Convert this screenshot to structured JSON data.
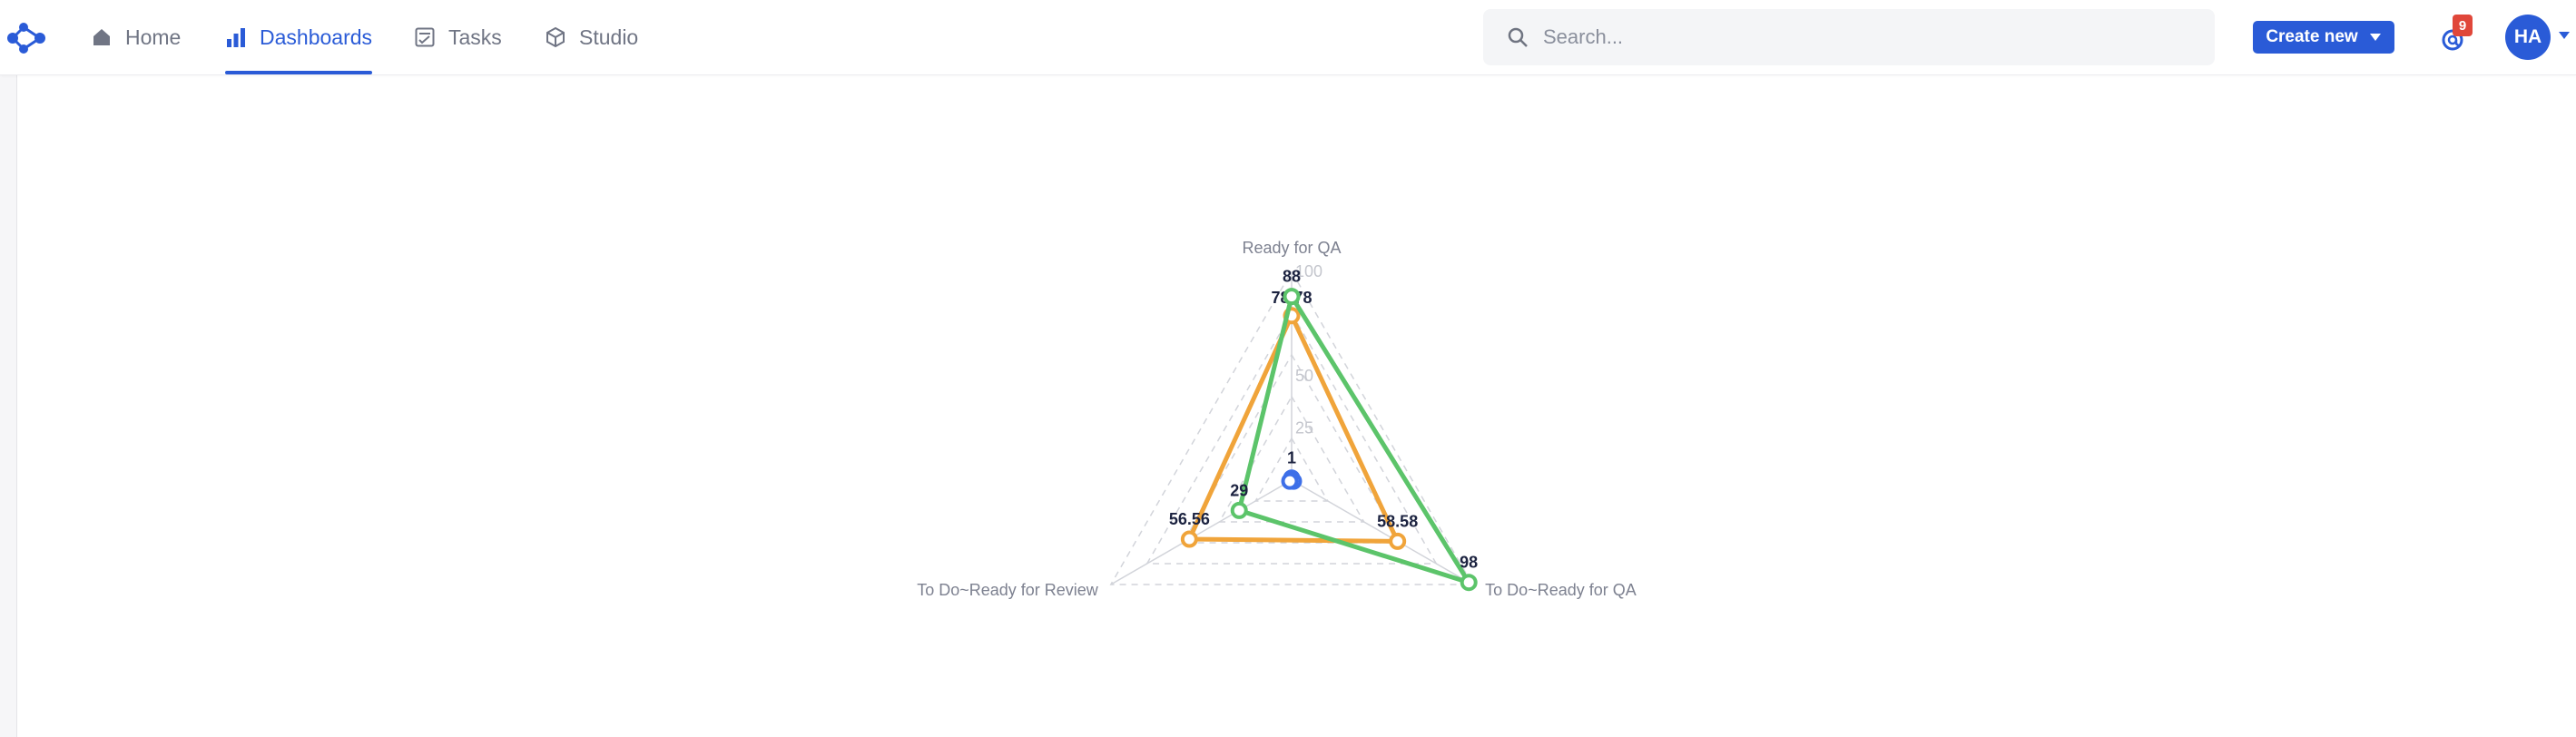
{
  "nav": {
    "items": [
      {
        "label": "Home",
        "icon": "home-icon"
      },
      {
        "label": "Dashboards",
        "icon": "bar-chart-icon",
        "active": true
      },
      {
        "label": "Tasks",
        "icon": "tasks-icon"
      },
      {
        "label": "Studio",
        "icon": "cube-icon"
      }
    ]
  },
  "search": {
    "placeholder": "Search..."
  },
  "actions": {
    "create_label": "Create new",
    "notification_count": "9",
    "avatar_initials": "HA"
  },
  "colors": {
    "accent": "#2a5bd7",
    "series_orange": "#f0a43a",
    "series_green": "#5cc46a",
    "series_blue": "#3d6fe8",
    "badge": "#e0473a"
  },
  "chart_data": {
    "type": "radar",
    "axes": [
      "Ready for QA",
      "To Do~Ready for QA",
      "To Do~Ready for Review"
    ],
    "rlim": [
      0,
      100
    ],
    "ticks": [
      25,
      50,
      100
    ],
    "grid": true,
    "legend": "none",
    "series": [
      {
        "color": "#f0a43a",
        "values": [
          78.78,
          58.58,
          56.56
        ],
        "labels": [
          "78.78",
          "58.58",
          "56.56"
        ]
      },
      {
        "color": "#5cc46a",
        "values": [
          88,
          98,
          29
        ],
        "labels": [
          "88",
          "98",
          "29"
        ]
      },
      {
        "color": "#3d6fe8",
        "values": [
          1,
          1,
          1
        ],
        "labels": [
          "1",
          "",
          ""
        ]
      }
    ]
  }
}
